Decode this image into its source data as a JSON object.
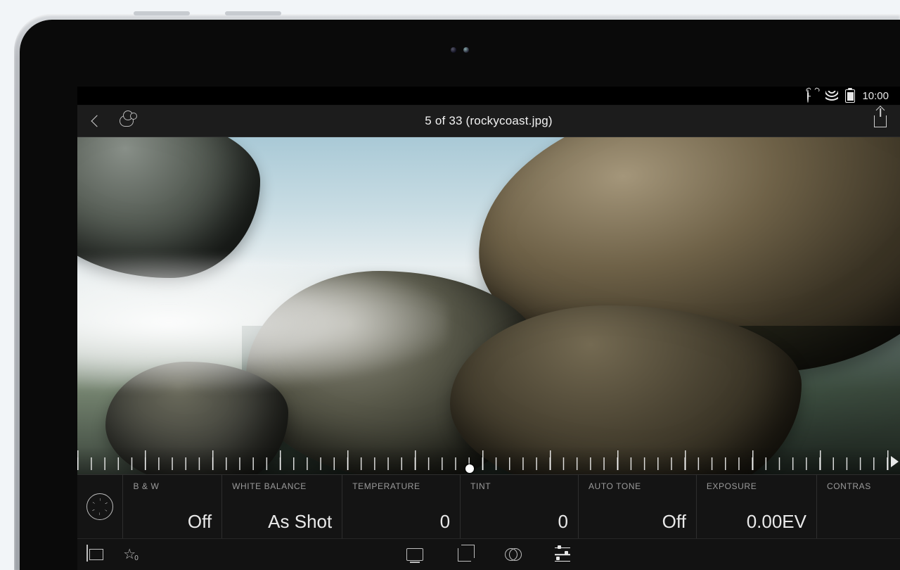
{
  "statusbar": {
    "time": "10:00"
  },
  "header": {
    "title": "5 of 33 (rockycoast.jpg)"
  },
  "adjustments": {
    "bw": {
      "label": "B & W",
      "value": "Off"
    },
    "wb": {
      "label": "WHITE BALANCE",
      "value": "As Shot"
    },
    "temp": {
      "label": "TEMPERATURE",
      "value": "0"
    },
    "tint": {
      "label": "TINT",
      "value": "0"
    },
    "autotone": {
      "label": "AUTO TONE",
      "value": "Off"
    },
    "exposure": {
      "label": "EXPOSURE",
      "value": "0.00EV"
    },
    "contrast": {
      "label": "CONTRAS",
      "value": ""
    }
  },
  "toolbar": {
    "star_count": "0"
  }
}
